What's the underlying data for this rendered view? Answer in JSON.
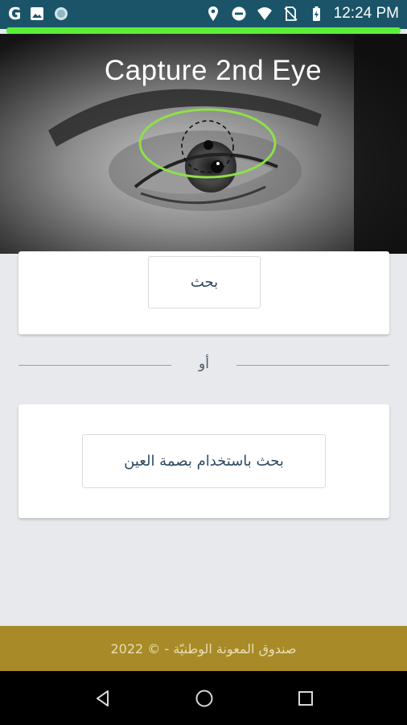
{
  "status_bar": {
    "left_icons": [
      "google-icon",
      "image-icon",
      "circle-app-icon"
    ],
    "google_letter": "G",
    "right_icons": [
      "location-icon",
      "do-not-disturb-icon",
      "wifi-icon",
      "no-sim-icon",
      "battery-charging-icon"
    ],
    "time": "12:24 PM"
  },
  "capture": {
    "title": "Capture 2nd Eye",
    "progress": 1.0,
    "progress_color": "#5bef38",
    "guide_color": "#8de04a"
  },
  "search_card": {
    "button_label": "بحث"
  },
  "divider": {
    "label": "أو"
  },
  "iris_card": {
    "button_label": "بحث باستخدام بصمة العين"
  },
  "footer": {
    "text": "صندوق المعونة الوطنيّة - © 2022",
    "background": "#a88a28"
  },
  "nav_bar": {
    "buttons": [
      "back-icon",
      "home-icon",
      "recents-icon"
    ]
  }
}
